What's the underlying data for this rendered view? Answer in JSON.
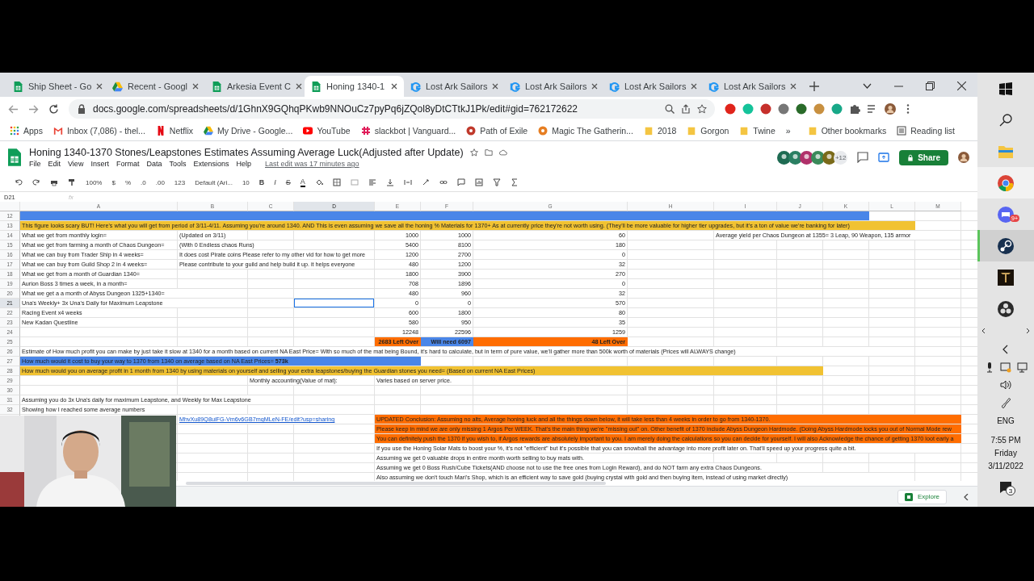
{
  "browser": {
    "tabs": [
      {
        "title": "Ship Sheet - Go",
        "selected": false
      },
      {
        "title": "Recent - Googl",
        "selected": false
      },
      {
        "title": "Arkesia Event C",
        "selected": false
      },
      {
        "title": "Honing 1340-1",
        "selected": true
      },
      {
        "title": "Lost Ark Sailors",
        "selected": false
      },
      {
        "title": "Lost Ark Sailors",
        "selected": false
      },
      {
        "title": "Lost Ark Sailors",
        "selected": false
      },
      {
        "title": "Lost Ark Sailors",
        "selected": false
      }
    ],
    "url": "docs.google.com/spreadsheets/d/1GhnX9GQhqPKwb9NNOuCz7pyPq6jZQol8yDtCTtkJ1Pk/edit#gid=762172622",
    "bookmarks": [
      "Apps",
      "Inbox (7,086) - thel...",
      "Netflix",
      "My Drive - Google...",
      "YouTube",
      "slackbot | Vanguard...",
      "Path of Exile",
      "Magic The Gatherin...",
      "2018",
      "Gorgon",
      "Twine"
    ],
    "more_bookmarks": "»",
    "other_bookmarks": "Other bookmarks",
    "reading_list": "Reading list"
  },
  "sheet": {
    "title": "Honing 1340-1370 Stones/Leapstones Estimates Assuming Average Luck(Adjusted after Update)",
    "menu": [
      "File",
      "Edit",
      "View",
      "Insert",
      "Format",
      "Data",
      "Tools",
      "Extensions",
      "Help"
    ],
    "last_edit": "Last edit was 17 minutes ago",
    "collaborators_more": "+12",
    "share": "Share",
    "toolbar": {
      "zoom": "100%",
      "currency": "$",
      "percent": "%",
      "decimal_less": ".0",
      "decimal_more": ".00",
      "number_format": "123",
      "font": "Default (Ari...",
      "font_size": "10",
      "bold": "B",
      "italic": "I",
      "strikethrough": "S",
      "text_color": "A"
    },
    "name_box": "D21",
    "formula_label": "fx",
    "columns": [
      "A",
      "B",
      "C",
      "D",
      "E",
      "F",
      "G",
      "H",
      "I",
      "J",
      "K",
      "L",
      "M"
    ],
    "rows": [
      {
        "num": "12",
        "cells": [
          {
            "color": "#4a86e8"
          },
          {
            "color": "#4a86e8"
          },
          {
            "color": "#4a86e8"
          },
          {
            "color": "#4a86e8"
          },
          {
            "color": "#4a86e8"
          },
          {
            "color": "#4a86e8"
          },
          {
            "color": "#4a86e8"
          },
          {
            "color": "#4a86e8"
          },
          {
            "color": "#4a86e8"
          },
          {
            "color": "#4a86e8"
          },
          {
            "color": "#4a86e8"
          },
          "",
          ""
        ]
      },
      {
        "num": "13",
        "cells": [
          {
            "text": "This figure looks scary BUT! Here's what you will get from period of 3/11-4/11. Assuming you're around 1340. AND This is even assuming we save all the honing % Materials for 1370+ As at currently price they're not worth using. (They'll be more valuable for higher tier upgrades, but it's a ton of value we're banking for later)",
            "color": "#f1c232"
          },
          {
            "color": "#f1c232"
          },
          {
            "color": "#f1c232"
          },
          {
            "color": "#f1c232"
          },
          {
            "color": "#f1c232"
          },
          {
            "color": "#f1c232"
          },
          {
            "color": "#f1c232"
          },
          {
            "color": "#f1c232"
          },
          {
            "color": "#f1c232"
          },
          {
            "color": "#f1c232"
          },
          {
            "color": "#f1c232"
          },
          {
            "color": "#f1c232"
          },
          ""
        ]
      },
      {
        "num": "14",
        "cells": [
          "What we get from monthly login=",
          "(Updated on 3/11)",
          "",
          "",
          {
            "text": "1000",
            "kind": "number"
          },
          {
            "text": "1000",
            "kind": "number"
          },
          {
            "text": "60",
            "kind": "number"
          },
          "",
          "Average yield per Chaos Dungeon at 1355= 3 Leap, 90 Weapon, 135 armor",
          "",
          "",
          "",
          ""
        ]
      },
      {
        "num": "15",
        "cells": [
          "What we get from farming a month of Chaos Dungeon=",
          "(With 0 Endless chaos Runs)",
          "",
          "",
          {
            "text": "5400",
            "kind": "number"
          },
          {
            "text": "8100",
            "kind": "number"
          },
          {
            "text": "180",
            "kind": "number"
          },
          "",
          "",
          "",
          "",
          "",
          ""
        ]
      },
      {
        "num": "16",
        "cells": [
          "What we can buy from Trader Ship in 4 weeks=",
          "It does cost Pirate coins Please refer to my other vid for how to get more",
          "",
          "",
          {
            "text": "1200",
            "kind": "number"
          },
          {
            "text": "2700",
            "kind": "number"
          },
          {
            "text": "0",
            "kind": "number"
          },
          "",
          "",
          "",
          "",
          "",
          ""
        ]
      },
      {
        "num": "17",
        "cells": [
          "What we can buy from Guild Shop 2 in 4 weeks=",
          "Please contribute to your guild and help build it up. it helps everyone",
          "",
          "",
          {
            "text": "480",
            "kind": "number"
          },
          {
            "text": "1200",
            "kind": "number"
          },
          {
            "text": "32",
            "kind": "number"
          },
          "",
          "",
          "",
          "",
          "",
          ""
        ]
      },
      {
        "num": "18",
        "cells": [
          "What we get from a month of Guardian 1340=",
          "",
          "",
          "",
          {
            "text": "1800",
            "kind": "number"
          },
          {
            "text": "3900",
            "kind": "number"
          },
          {
            "text": "270",
            "kind": "number"
          },
          "",
          "",
          "",
          "",
          "",
          ""
        ]
      },
      {
        "num": "19",
        "cells": [
          "Aurion Boss 3 times a week, in a month=",
          "",
          "",
          "",
          {
            "text": "708",
            "kind": "number"
          },
          {
            "text": "1896",
            "kind": "number"
          },
          {
            "text": "0",
            "kind": "number"
          },
          "",
          "",
          "",
          "",
          "",
          ""
        ]
      },
      {
        "num": "20",
        "cells": [
          "What we get a a month of Abyss Dungeon 1325+1340=",
          "",
          "",
          "",
          {
            "text": "480",
            "kind": "number"
          },
          {
            "text": "960",
            "kind": "number"
          },
          {
            "text": "32",
            "kind": "number"
          },
          "",
          "",
          "",
          "",
          "",
          ""
        ]
      },
      {
        "num": "21",
        "cells": [
          "Una's Weekly+ 3x Una's Daily for Maximum Leapstone",
          "",
          "",
          {
            "selected": true
          },
          {
            "text": "0",
            "kind": "number"
          },
          {
            "text": "0",
            "kind": "number"
          },
          {
            "text": "570",
            "kind": "number"
          },
          "",
          "",
          "",
          "",
          "",
          ""
        ]
      },
      {
        "num": "22",
        "cells": [
          "Racing Event x4 weeks",
          "",
          "",
          "",
          {
            "text": "600",
            "kind": "number"
          },
          {
            "text": "1800",
            "kind": "number"
          },
          {
            "text": "80",
            "kind": "number"
          },
          "",
          "",
          "",
          "",
          "",
          ""
        ]
      },
      {
        "num": "23",
        "cells": [
          "New Kadan Questline",
          "",
          "",
          "",
          {
            "text": "580",
            "kind": "number"
          },
          {
            "text": "950",
            "kind": "number"
          },
          {
            "text": "35",
            "kind": "number"
          },
          "",
          "",
          "",
          "",
          "",
          ""
        ]
      },
      {
        "num": "24",
        "cells": [
          "",
          "",
          "",
          "",
          {
            "text": "12248",
            "kind": "number"
          },
          {
            "text": "22596",
            "kind": "number"
          },
          {
            "text": "1259",
            "kind": "number"
          },
          "",
          "",
          "",
          "",
          "",
          ""
        ]
      },
      {
        "num": "25",
        "cells": [
          "",
          "",
          "",
          "",
          {
            "text": "2683 Left Over",
            "kind": "number",
            "bold": true,
            "color": "#ff6d01"
          },
          {
            "text": "Will need 6097",
            "kind": "number",
            "bold": true,
            "color": "#4a86e8"
          },
          {
            "text": "48 Left Over",
            "kind": "number",
            "bold": true,
            "color": "#ff6d01"
          },
          "",
          "",
          "",
          "",
          "",
          ""
        ]
      },
      {
        "num": "26",
        "cells": [
          "Estimate of How much profit you can make by just take it slow at 1340 for a month based on current NA East Price= With so much of the mat being Bound, it's hard to calculate, but in term of pure value, we'll gather more than 500k worth of materials  (Prices will ALWAYS change)",
          "",
          "",
          "",
          "",
          "",
          "",
          "",
          "",
          "",
          "",
          "",
          ""
        ]
      },
      {
        "num": "27",
        "cells": [
          {
            "text": "How much would it cost to buy your way to 1370 from 1340 on average based on NA East Prices= **573k**",
            "color": "#4a86e8"
          },
          {
            "color": "#4a86e8"
          },
          {
            "color": "#4a86e8"
          },
          {
            "color": "#4a86e8"
          },
          {
            "color": "#4a86e8"
          },
          "",
          "",
          "",
          "",
          "",
          "",
          "",
          ""
        ]
      },
      {
        "num": "28",
        "cells": [
          {
            "text": "How much would you on average profit in 1 month from 1340 by using materials on yourself and selling your extra leapstones/buying the Guardian stones you need=  (Based on current NA East Prices)",
            "color": "#f1c232"
          },
          {
            "color": "#f1c232"
          },
          {
            "color": "#f1c232"
          },
          {
            "color": "#f1c232"
          },
          {
            "color": "#f1c232"
          },
          {
            "color": "#f1c232"
          },
          {
            "color": "#f1c232"
          },
          {
            "color": "#f1c232"
          },
          {
            "color": "#f1c232"
          },
          {
            "color": "#f1c232"
          },
          "",
          "",
          ""
        ]
      },
      {
        "num": "29",
        "cells": [
          "",
          "",
          "Monthly accounting(Value of mat):",
          "",
          "Varies based on server price.",
          "",
          "",
          "",
          "",
          "",
          "",
          "",
          ""
        ]
      },
      {
        "num": "30",
        "cells": [
          "",
          "",
          "",
          "",
          "",
          "",
          "",
          "",
          "",
          "",
          "",
          "",
          ""
        ]
      },
      {
        "num": "31",
        "cells": [
          "Assuming you do 3x Una's daily for maximum Leapstone, and Weekly for Max Leapstone",
          "",
          "",
          "",
          "",
          "",
          "",
          "",
          "",
          "",
          "",
          "",
          ""
        ]
      },
      {
        "num": "32",
        "cells": [
          "Showing how I reached some average numbers",
          "",
          "",
          "",
          "",
          "",
          "",
          "",
          "",
          "",
          "",
          "",
          ""
        ]
      },
      {
        "cells": [
          "",
          {
            "text": "MhvXu89Q8uiFG-Vm6v6GB7mqMLeN-FE/edit?usp=sharing",
            "link": true
          },
          "",
          "",
          {
            "text": "UPDATED Conclusion: Assuming no alts, Average honing luck and all the things down below, it will take less than 4 weeks in order to go from 1340-1370.",
            "color": "#ff6d01"
          },
          {
            "color": "#ff6d01"
          },
          {
            "color": "#ff6d01"
          },
          {
            "color": "#ff6d01"
          },
          {
            "color": "#ff6d01"
          },
          {
            "color": "#ff6d01"
          },
          {
            "color": "#ff6d01"
          },
          {
            "color": "#ff6d01"
          },
          {
            "color": "#ff6d01"
          }
        ]
      },
      {
        "cells": [
          "",
          "",
          "",
          "",
          {
            "text": "Please keep in mind we are only missing 1 Argos Per WEEK. That's the main thing we're \"missing out\" on. Other benefit of 1370 include Abyss Dungeon Hardmode. (Doing Abyss Hardmode locks you out of Normal Mode rew",
            "color": "#ff6d01"
          },
          {
            "color": "#ff6d01"
          },
          {
            "color": "#ff6d01"
          },
          {
            "color": "#ff6d01"
          },
          {
            "color": "#ff6d01"
          },
          {
            "color": "#ff6d01"
          },
          {
            "color": "#ff6d01"
          },
          {
            "color": "#ff6d01"
          },
          {
            "color": "#ff6d01"
          }
        ]
      },
      {
        "cells": [
          "",
          "",
          "",
          "",
          {
            "text": "You can definitely push the 1370 if you wish to, if Argos rewards are absolutely important to you. I am merely doing the calculations so you can decide for yourself. I will also Acknowledge the chance of getting 1370 loot early a",
            "color": "#ff6d01"
          },
          {
            "color": "#ff6d01"
          },
          {
            "color": "#ff6d01"
          },
          {
            "color": "#ff6d01"
          },
          {
            "color": "#ff6d01"
          },
          {
            "color": "#ff6d01"
          },
          {
            "color": "#ff6d01"
          },
          {
            "color": "#ff6d01"
          },
          {
            "color": "#ff6d01"
          }
        ]
      },
      {
        "cells": [
          "",
          "",
          "",
          "",
          "If you use the Honing Solar Mats to boost your %, it's not \"efficient\" but it's possible that you can snowball the advantage into more profit later on. That'll speed up your progress quite a bit.",
          "",
          "",
          "",
          "",
          "",
          "",
          "",
          ""
        ]
      },
      {
        "cells": [
          "",
          "",
          "",
          "",
          "Assuming we get 0 valuable drops in entire month worth selling to buy mats with.",
          "",
          "",
          "",
          "",
          "",
          "",
          "",
          ""
        ]
      },
      {
        "cells": [
          "",
          "",
          "",
          "",
          "Assuming we get 0 Boss Rush/Cube Tickets(AND choose not to use the free ones from Login Reward), and do NOT farm any extra Chaos Dungeons.",
          "",
          "",
          "",
          "",
          "",
          "",
          "",
          ""
        ]
      },
      {
        "cells": [
          "",
          "",
          "",
          "",
          "Also assuming we don't touch Mari's Shop, which is an efficient way to save gold (buying crystal with gold and then buying item, instead of using market directly)",
          "",
          "",
          "",
          "",
          "",
          "",
          "",
          ""
        ]
      }
    ],
    "explore": "Explore"
  },
  "taskbar": {
    "badge": "9+",
    "language": "ENG",
    "time": "7:55 PM",
    "day": "Friday",
    "date": "3/11/2022",
    "notifications": "3"
  }
}
